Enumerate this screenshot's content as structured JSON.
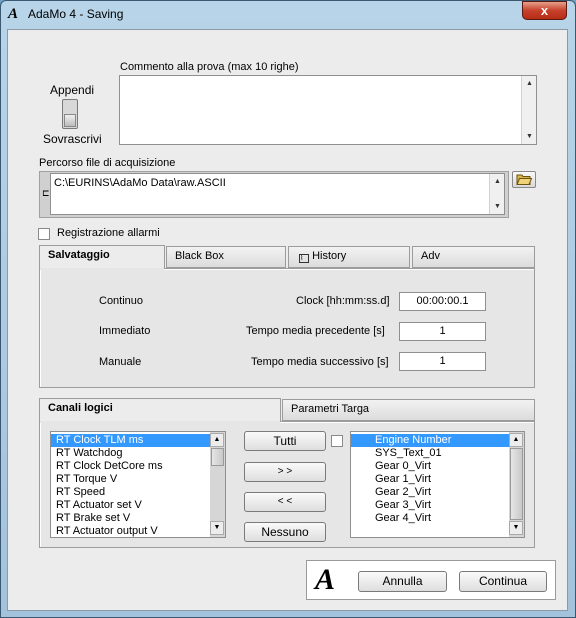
{
  "window": {
    "title": "AdaMo 4 - Saving",
    "app_icon_glyph": "A",
    "close_glyph": "x"
  },
  "mode": {
    "append_label": "Appendi",
    "overwrite_label": "Sovrascrivi"
  },
  "comment": {
    "label": "Commento alla prova (max 10 righe)",
    "value": ""
  },
  "path": {
    "label": "Percorso file di acquisizione",
    "value": "C:\\EURINS\\AdaMo Data\\raw.ASCII"
  },
  "alarms": {
    "label": "Registrazione allarmi",
    "checked": false
  },
  "tabs1": {
    "items": [
      "Salvataggio",
      "Black Box",
      "History",
      "Adv"
    ],
    "active": "Salvataggio"
  },
  "saving": {
    "continuo": "Continuo",
    "immediato": "Immediato",
    "manuale": "Manuale",
    "clock_label": "Clock [hh:mm:ss.d]",
    "clock_value": "00:00:00.1",
    "prev_label": "Tempo media precedente [s]",
    "prev_value": "1",
    "next_label": "Tempo media successivo [s]",
    "next_value": "1"
  },
  "tabs2": {
    "items": [
      "Canali logici",
      "Parametri Targa"
    ],
    "active": "Canali logici"
  },
  "channels": {
    "left": [
      "RT Clock TLM ms",
      "RT Watchdog",
      "RT Clock DetCore ms",
      "RT Torque V",
      "RT Speed",
      "RT Actuator set V",
      "RT Brake set V",
      "RT Actuator output V"
    ],
    "left_selected": 0,
    "right": [
      "Engine Number",
      "SYS_Text_01",
      "Gear 0_Virt",
      "Gear 1_Virt",
      "Gear 2_Virt",
      "Gear 3_Virt",
      "Gear 4_Virt"
    ],
    "right_selected": 0,
    "btn_all": "Tutti",
    "btn_add": "> >",
    "btn_remove": "< <",
    "btn_none": "Nessuno"
  },
  "footer": {
    "logo": "A",
    "cancel": "Annulla",
    "continue": "Continua"
  },
  "colors": {
    "selection": "#3399ff",
    "close_button": "#c7402b"
  }
}
